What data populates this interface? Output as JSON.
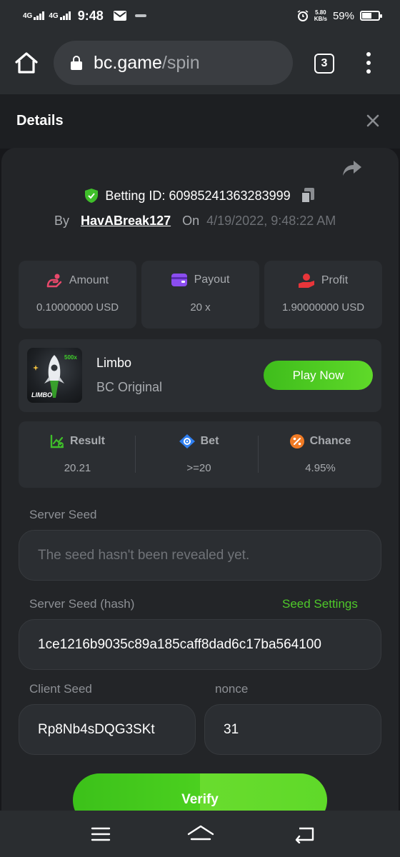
{
  "status_bar": {
    "net1": "4G",
    "net2": "4G",
    "time": "9:48",
    "speed_value": "5.80",
    "speed_unit": "KB/s",
    "battery": "59%",
    "battery_level": 0.59
  },
  "browser": {
    "domain": "bc.game",
    "path": "/spin",
    "tab_count": "3"
  },
  "details": {
    "title": "Details"
  },
  "bet": {
    "id_label": "Betting ID:",
    "id_value": "60985241363283999",
    "by_label": "By",
    "user": "HavABreak127",
    "on_label": "On",
    "date": "4/19/2022, 9:48:22 AM"
  },
  "stats": [
    {
      "label": "Amount",
      "value": "0.10000000 USD",
      "icon": "amount-icon"
    },
    {
      "label": "Payout",
      "value": "20 x",
      "icon": "wallet-icon"
    },
    {
      "label": "Profit",
      "value": "1.90000000 USD",
      "icon": "profit-icon"
    }
  ],
  "game": {
    "name": "Limbo",
    "provider": "BC Original",
    "play_label": "Play Now",
    "thumb_text": "LIMBO",
    "thumb_multiplier": "500x"
  },
  "result": [
    {
      "label": "Result",
      "value": "20.21",
      "icon": "chart-check-icon"
    },
    {
      "label": "Bet",
      "value": ">=20",
      "icon": "target-icon"
    },
    {
      "label": "Chance",
      "value": "4.95%",
      "icon": "percent-icon"
    }
  ],
  "seeds": {
    "server_seed_label": "Server Seed",
    "server_seed_value": "The seed hasn't been revealed yet.",
    "server_hash_label": "Server Seed (hash)",
    "seed_settings_label": "Seed Settings",
    "server_hash_value": "1ce1216b9035c89a185caff8dad6c17ba564100",
    "client_seed_label": "Client Seed",
    "client_seed_value": "Rp8Nb4sDQG3SKt",
    "nonce_label": "nonce",
    "nonce_value": "31"
  },
  "verify_label": "Verify",
  "colors": {
    "accent_green": "#4fc92a",
    "shield_green": "#3fbf2a",
    "amount_pink": "#e8496b",
    "payout_purple": "#8b4df0",
    "profit_red": "#e8353a",
    "bet_blue": "#2f7ff0",
    "chance_orange": "#f07a24"
  }
}
